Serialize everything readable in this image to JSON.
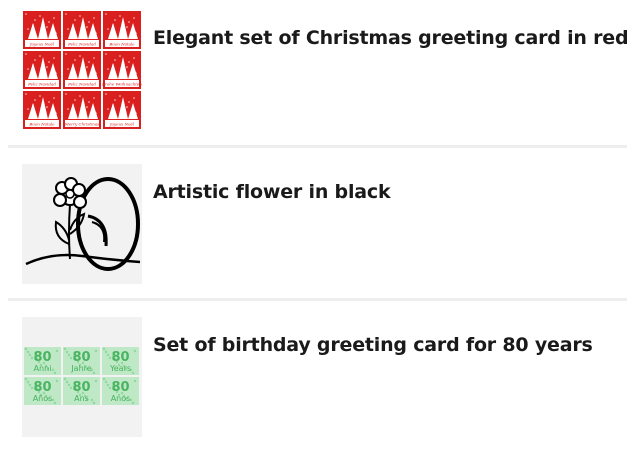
{
  "items": [
    {
      "title": "Elegant set of Christmas greeting card in red",
      "thumb_icon": "christmas-cards-grid-icon",
      "card_texts": [
        "Joyeux Noël",
        "Feliz Navidad",
        "Buon Natale",
        "Feliz Navidad",
        "Feliz Navidad",
        "Frohe Weihnachten",
        "Buon Natale",
        "Merry Christmas",
        "Joyeux Noël"
      ],
      "accent": "#d9201f"
    },
    {
      "title": "Artistic flower in black",
      "thumb_icon": "flower-drawing-icon",
      "accent": "#000000"
    },
    {
      "title": "Set of birthday greeting card for 80 years",
      "thumb_icon": "birthday-80-cards-grid-icon",
      "card_texts": [
        {
          "number": "80",
          "word": "Anni"
        },
        {
          "number": "80",
          "word": "Jahre"
        },
        {
          "number": "80",
          "word": "Years"
        },
        {
          "number": "80",
          "word": "Años"
        },
        {
          "number": "80",
          "word": "Ans"
        },
        {
          "number": "80",
          "word": "Anos"
        }
      ],
      "accent": "#2ea84a"
    }
  ]
}
